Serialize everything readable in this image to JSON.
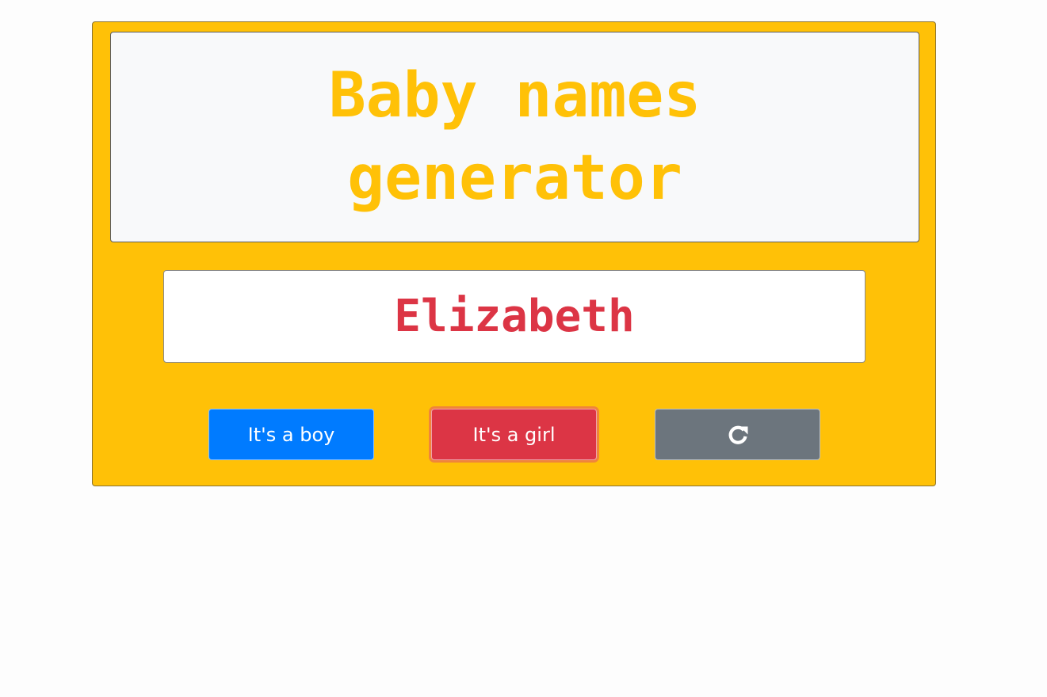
{
  "header": {
    "title": "Baby names generator"
  },
  "result": {
    "name": "Elizabeth"
  },
  "actions": {
    "boy_label": "It's a boy",
    "girl_label": "It's a girl",
    "refresh_icon": "refresh-icon"
  },
  "colors": {
    "accent": "#ffc107",
    "name_color": "#dc3545",
    "boy_button": "#007bff",
    "girl_button": "#dc3545",
    "refresh_button": "#6c757d"
  }
}
